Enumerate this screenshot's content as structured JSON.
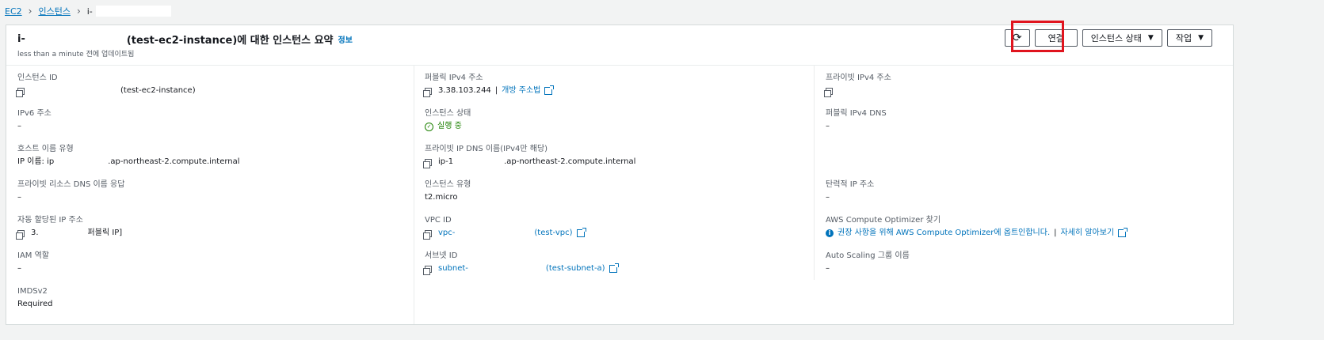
{
  "breadcrumb": {
    "root": "EC2",
    "section": "인스턴스",
    "current": "i-"
  },
  "header": {
    "title_prefix": "i-",
    "title_suffix": "(test-ec2-instance)에 대한 인스턴스 요약",
    "info_link": "정보",
    "updated": "less than a minute 전에 업데이트됨"
  },
  "buttons": {
    "connect": "연결",
    "instance_state": "인스턴스 상태",
    "actions": "작업"
  },
  "fields": {
    "instance_id": {
      "label": "인스턴스 ID",
      "value": "(test-ec2-instance)"
    },
    "public_ipv4": {
      "label": "퍼블릭 IPv4 주소",
      "value": "3.38.103.244",
      "link": "개방 주소법"
    },
    "private_ipv4": {
      "label": "프라이빗 IPv4 주소",
      "value": ""
    },
    "ipv6": {
      "label": "IPv6 주소",
      "value": "–"
    },
    "instance_state": {
      "label": "인스턴스 상태",
      "value": "실행 중"
    },
    "public_dns": {
      "label": "퍼블릭 IPv4 DNS",
      "value": "–"
    },
    "hostname_type": {
      "label": "호스트 이름 유형",
      "value_prefix": "IP 이름: ip",
      "value_suffix": ".ap-northeast-2.compute.internal"
    },
    "private_dns": {
      "label": "프라이빗 IP DNS 이름(IPv4만 해당)",
      "value_prefix": "ip-1",
      "value_suffix": ".ap-northeast-2.compute.internal"
    },
    "resource_dns": {
      "label": "프라이빗 리소스 DNS 이름 응답",
      "value": "–"
    },
    "instance_type": {
      "label": "인스턴스 유형",
      "value": "t2.micro"
    },
    "elastic_ip": {
      "label": "탄력적 IP 주소",
      "value": "–"
    },
    "auto_ip": {
      "label": "자동 할당된 IP 주소",
      "value_prefix": "3.",
      "value_suffix": "퍼블릭 IP]"
    },
    "vpc": {
      "label": "VPC ID",
      "value_prefix": "vpc-",
      "value_suffix": "(test-vpc)"
    },
    "optimizer": {
      "label": "AWS Compute Optimizer 찾기",
      "text": "권장 사항을 위해 AWS Compute Optimizer에 옵트인합니다.",
      "link": "자세히 알아보기"
    },
    "iam_role": {
      "label": "IAM 역할",
      "value": "–"
    },
    "subnet": {
      "label": "서브넷 ID",
      "value_prefix": "subnet-",
      "value_suffix": "(test-subnet-a)"
    },
    "asg": {
      "label": "Auto Scaling 그룹 이름",
      "value": "–"
    },
    "imdsv2": {
      "label": "IMDSv2",
      "value": "Required"
    }
  },
  "colors": {
    "link": "#0073bb",
    "success": "#1d8102",
    "highlight": "#e0141e"
  }
}
